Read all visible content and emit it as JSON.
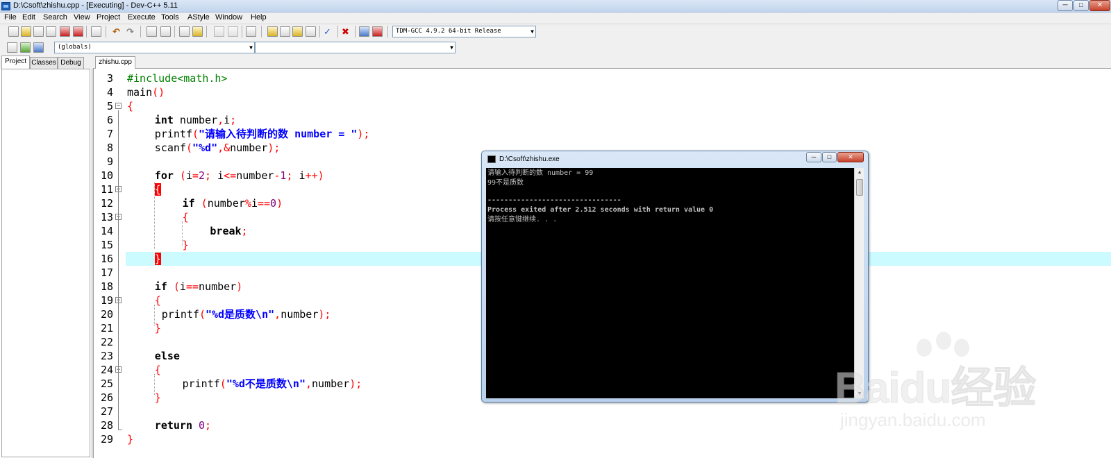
{
  "window": {
    "title": "D:\\Csoft\\zhishu.cpp - [Executing] - Dev-C++ 5.11",
    "min": "─",
    "max": "□",
    "close": "✕"
  },
  "menu": [
    "File",
    "Edit",
    "Search",
    "View",
    "Project",
    "Execute",
    "Tools",
    "AStyle",
    "Window",
    "Help"
  ],
  "toolbar": {
    "compiler": "TDM-GCC 4.9.2 64-bit Release",
    "scope": "(globals)",
    "member": ""
  },
  "left_panel": {
    "tabs": [
      "Project",
      "Classes",
      "Debug"
    ]
  },
  "editor": {
    "tab": "zhishu.cpp",
    "line_numbers": [
      "3",
      "4",
      "5",
      "6",
      "7",
      "8",
      "9",
      "10",
      "11",
      "12",
      "13",
      "14",
      "15",
      "16",
      "17",
      "18",
      "19",
      "20",
      "21",
      "22",
      "23",
      "24",
      "25",
      "26",
      "27",
      "28",
      "29"
    ]
  },
  "code": {
    "l3": "#include<math.h>",
    "l4": "main",
    "l4p": "()",
    "l5": "{",
    "l6_kw": "int",
    "l6_a": " number",
    "l6_b": ",",
    "l6_c": "i",
    "l6_d": ";",
    "l7_a": "printf",
    "l7_b": "(",
    "l7_c": "\"请输入待判断的数 number = \"",
    "l7_d": ");",
    "l8_a": "scanf",
    "l8_b": "(",
    "l8_c": "\"%d\"",
    "l8_d": ",&",
    "l8_e": "number",
    "l8_f": ");",
    "l10_kw": "for",
    "l10_a": " (",
    "l10_b": "i",
    "l10_c": "=",
    "l10_d": "2",
    "l10_e": "; ",
    "l10_f": "i",
    "l10_g": "<=",
    "l10_h": "number",
    "l10_i": "-",
    "l10_j": "1",
    "l10_k": "; ",
    "l10_l": "i",
    "l10_m": "++)",
    "l11": "{",
    "l12_kw": "if",
    "l12_a": " (",
    "l12_b": "number",
    "l12_c": "%",
    "l12_d": "i",
    "l12_e": "==",
    "l12_f": "0",
    "l12_g": ")",
    "l13": "{",
    "l14_kw": "break",
    "l14_a": ";",
    "l15": "}",
    "l16": "}",
    "l18_kw": "if",
    "l18_a": " (",
    "l18_b": "i",
    "l18_c": "==",
    "l18_d": "number",
    "l18_e": ")",
    "l19": "{",
    "l20_a": "printf",
    "l20_b": "(",
    "l20_c": "\"%d是质数\\n\"",
    "l20_d": ",",
    "l20_e": "number",
    "l20_f": ");",
    "l21": "}",
    "l23_kw": "else",
    "l24": "{",
    "l25_a": "printf",
    "l25_b": "(",
    "l25_c": "\"%d不是质数\\n\"",
    "l25_d": ",",
    "l25_e": "number",
    "l25_f": ");",
    "l26": "}",
    "l28_kw": "return",
    "l28_a": " ",
    "l28_b": "0",
    "l28_c": ";",
    "l29": "}"
  },
  "console": {
    "title": "D:\\Csoft\\zhishu.exe",
    "lines": [
      "请输入待判断的数 number = 99",
      "99不是质数",
      "",
      "--------------------------------",
      "Process exited after 2.512 seconds with return value 0",
      "请按任意键继续. . ."
    ]
  },
  "watermark": {
    "brand": "Baidu经验",
    "url": "jingyan.baidu.com"
  }
}
